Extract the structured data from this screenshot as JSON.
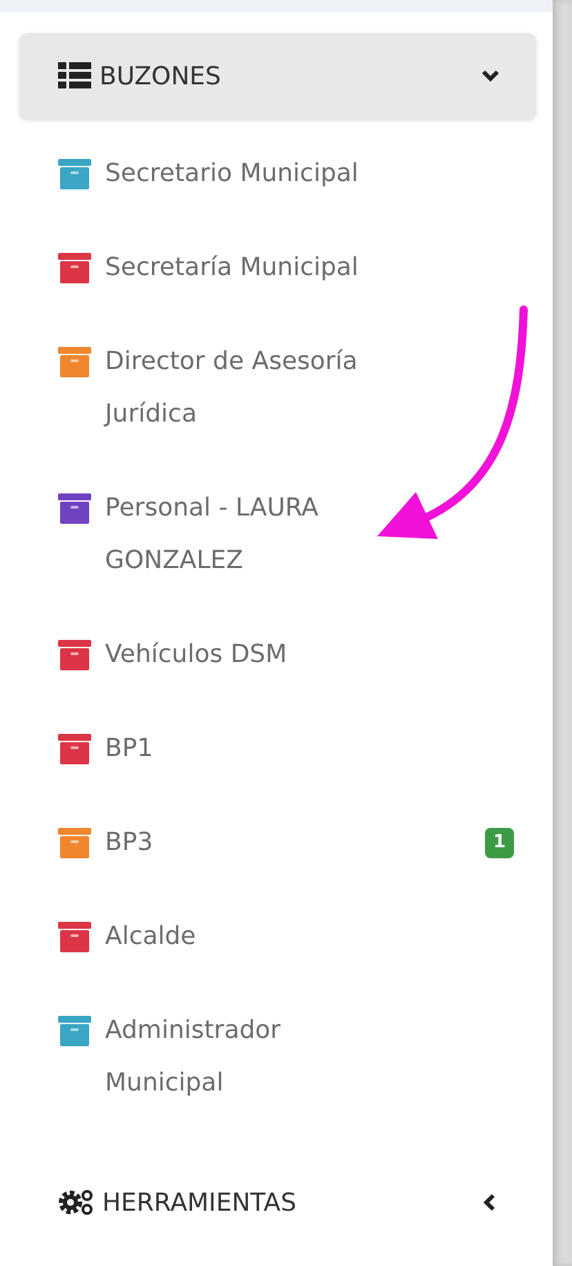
{
  "sections": [
    {
      "title": "BUZONES",
      "kind": "list",
      "expanded": true,
      "items": [
        {
          "label": "Secretario Municipal",
          "color": "#3aa6c4"
        },
        {
          "label": "Secretaría Municipal",
          "color": "#dc3545"
        },
        {
          "label": "Director de Asesoría Jurídica",
          "color": "#f0862e"
        },
        {
          "label": "Personal - LAURA GONZALEZ",
          "color": "#6f42c1"
        },
        {
          "label": "Vehículos DSM",
          "color": "#dc3545"
        },
        {
          "label": "BP1",
          "color": "#dc3545"
        },
        {
          "label": "BP3",
          "color": "#f0862e",
          "badge": "1"
        },
        {
          "label": "Alcalde",
          "color": "#dc3545"
        },
        {
          "label": "Administrador Municipal",
          "color": "#3aa6c4"
        }
      ]
    },
    {
      "title": "HERRAMIENTAS",
      "kind": "gears",
      "expanded": false
    }
  ]
}
